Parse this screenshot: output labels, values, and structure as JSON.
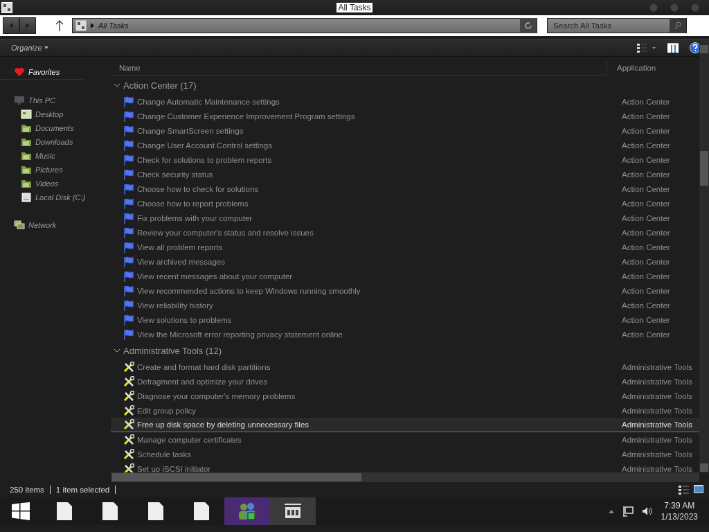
{
  "window": {
    "title": "All Tasks"
  },
  "address_bar": {
    "path": "All Tasks",
    "search_placeholder": "Search All Tasks"
  },
  "toolbar": {
    "organize": "Organize"
  },
  "sidebar": {
    "items": [
      {
        "label": "Favorites"
      },
      {
        "label": "This PC",
        "children": [
          {
            "label": "Desktop"
          },
          {
            "label": "Documents"
          },
          {
            "label": "Downloads"
          },
          {
            "label": "Music"
          },
          {
            "label": "Pictures"
          },
          {
            "label": "Videos"
          },
          {
            "label": "Local Disk (C:)"
          }
        ]
      },
      {
        "label": "Network"
      }
    ]
  },
  "table": {
    "columns": [
      "Name",
      "Application"
    ],
    "groups": [
      {
        "title": "Action Center (17)",
        "expanded": true,
        "kind": "flag",
        "rows": [
          {
            "name": "Change Automatic Maintenance settings",
            "application": "Action Center",
            "selected": false
          },
          {
            "name": "Change Customer Experience Improvement Program settings",
            "application": "Action Center",
            "selected": false
          },
          {
            "name": "Change SmartScreen settings",
            "application": "Action Center",
            "selected": false
          },
          {
            "name": "Change User Account Control settings",
            "application": "Action Center",
            "selected": false
          },
          {
            "name": "Check for solutions to problem reports",
            "application": "Action Center",
            "selected": false
          },
          {
            "name": "Check security status",
            "application": "Action Center",
            "selected": false
          },
          {
            "name": "Choose how to check for solutions",
            "application": "Action Center",
            "selected": false
          },
          {
            "name": "Choose how to report problems",
            "application": "Action Center",
            "selected": false
          },
          {
            "name": "Fix problems with your computer",
            "application": "Action Center",
            "selected": false
          },
          {
            "name": "Review your computer's status and resolve issues",
            "application": "Action Center",
            "selected": false
          },
          {
            "name": "View all problem reports",
            "application": "Action Center",
            "selected": false
          },
          {
            "name": "View archived messages",
            "application": "Action Center",
            "selected": false
          },
          {
            "name": "View recent messages about your computer",
            "application": "Action Center",
            "selected": false
          },
          {
            "name": "View recommended actions to keep Windows running smoothly",
            "application": "Action Center",
            "selected": false
          },
          {
            "name": "View reliability history",
            "application": "Action Center",
            "selected": false
          },
          {
            "name": "View solutions to problems",
            "application": "Action Center",
            "selected": false
          },
          {
            "name": "View the Microsoft error reporting privacy statement online",
            "application": "Action Center",
            "selected": false
          }
        ]
      },
      {
        "title": "Administrative Tools (12)",
        "expanded": true,
        "kind": "tools",
        "rows": [
          {
            "name": "Create and format hard disk partitions",
            "application": "Administrative Tools",
            "selected": false
          },
          {
            "name": "Defragment and optimize your drives",
            "application": "Administrative Tools",
            "selected": false
          },
          {
            "name": "Diagnose your computer's memory problems",
            "application": "Administrative Tools",
            "selected": false
          },
          {
            "name": "Edit group policy",
            "application": "Administrative Tools",
            "selected": false
          },
          {
            "name": "Free up disk space by deleting unnecessary files",
            "application": "Administrative Tools",
            "selected": true
          },
          {
            "name": "Manage computer certificates",
            "application": "Administrative Tools",
            "selected": false
          },
          {
            "name": "Schedule tasks",
            "application": "Administrative Tools",
            "selected": false
          },
          {
            "name": "Set up iSCSI initiator",
            "application": "Administrative Tools",
            "selected": false
          }
        ]
      }
    ]
  },
  "status_bar": {
    "items": [
      "250 items",
      "1 item selected"
    ]
  },
  "taskbar": {
    "apps": [
      {
        "kind": "document",
        "selected": false
      },
      {
        "kind": "document",
        "selected": false
      },
      {
        "kind": "document",
        "selected": false
      },
      {
        "kind": "document",
        "selected": false
      },
      {
        "kind": "people",
        "selected": true
      },
      {
        "kind": "window",
        "selected": false
      }
    ],
    "time": "7:39 AM",
    "date": "1/13/2023"
  }
}
